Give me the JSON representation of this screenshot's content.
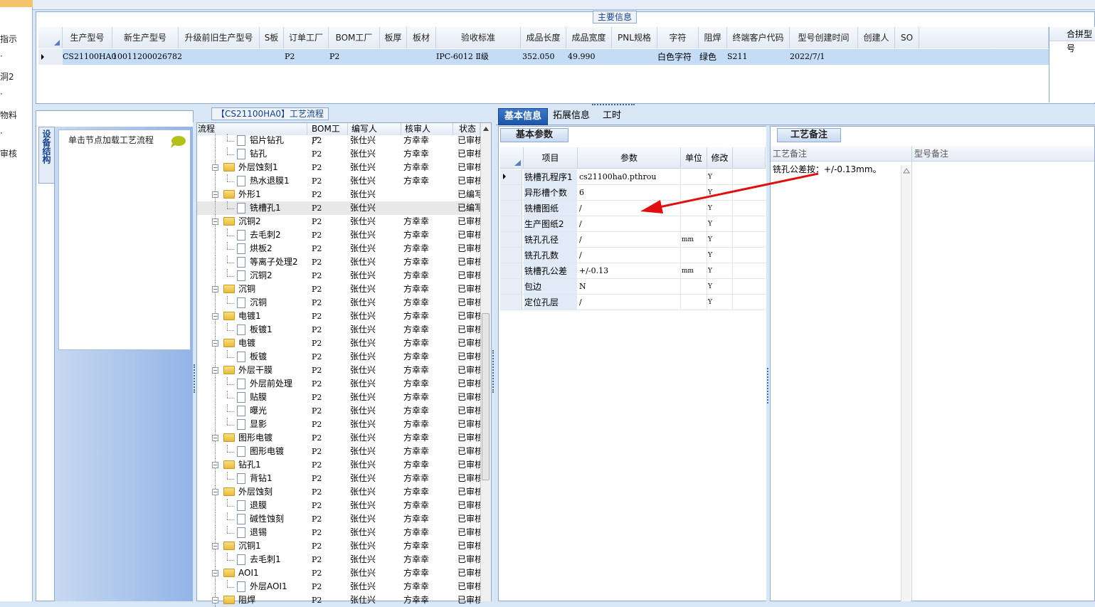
{
  "left_strip": {
    "labels": [
      "指示",
      "·",
      "洞2",
      "·",
      "物料",
      "·",
      "审核"
    ]
  },
  "main_info": {
    "title": "主要信息",
    "columns": [
      "生产型号",
      "新生产型号",
      "升级前旧生产型号",
      "S板",
      "订单工厂",
      "BOM工厂",
      "板厚",
      "板材",
      "验收标准",
      "成品长度",
      "成品宽度",
      "PNL规格",
      "字符",
      "阻焊",
      "终端客户代码",
      "型号创建时间",
      "创建人",
      "SO"
    ],
    "row": {
      "prod_model": "CS21100HA0",
      "new_model": "10011200026782",
      "old_model": "",
      "s_board": "",
      "order_factory": "P2",
      "bom_factory": "P2",
      "thickness": "",
      "material": "",
      "standard": "IPC-6012 Ⅱ级",
      "length": "352.050",
      "width": "49.990",
      "pnl": "",
      "char": "白色字符",
      "solder": "绿色",
      "customer_code": "S211",
      "created": "2022/7/1",
      "creator": "",
      "so": ""
    },
    "merge_label": "合拼型号"
  },
  "left_nav": {
    "tab_label": "设备结构",
    "hint": "单击节点加载工艺流程"
  },
  "flow": {
    "title": "【CS21100HA0】工艺流程",
    "columns": [
      "流程",
      "BOM工厂",
      "编写人",
      "核审人",
      "状态"
    ],
    "rows": [
      {
        "level": 2,
        "name": "铝片钻孔",
        "bom": "P2",
        "writer": "张仕兴",
        "reviewer": "方幸幸",
        "status": "已审核"
      },
      {
        "level": 2,
        "name": "钻孔",
        "bom": "P2",
        "writer": "张仕兴",
        "reviewer": "方幸幸",
        "status": "已审核"
      },
      {
        "level": 1,
        "name": "外层蚀刻1",
        "bom": "P2",
        "writer": "张仕兴",
        "reviewer": "方幸幸",
        "status": "已审核"
      },
      {
        "level": 2,
        "name": "热水退膜1",
        "bom": "P2",
        "writer": "张仕兴",
        "reviewer": "方幸幸",
        "status": "已审核"
      },
      {
        "level": 1,
        "name": "外形1",
        "bom": "P2",
        "writer": "张仕兴",
        "reviewer": "",
        "status": "已编写"
      },
      {
        "level": 2,
        "name": "铣槽孔1",
        "bom": "P2",
        "writer": "张仕兴",
        "reviewer": "",
        "status": "已编写",
        "selected": true
      },
      {
        "level": 1,
        "name": "沉铜2",
        "bom": "P2",
        "writer": "张仕兴",
        "reviewer": "方幸幸",
        "status": "已审核"
      },
      {
        "level": 2,
        "name": "去毛刺2",
        "bom": "P2",
        "writer": "张仕兴",
        "reviewer": "方幸幸",
        "status": "已审核"
      },
      {
        "level": 2,
        "name": "烘板2",
        "bom": "P2",
        "writer": "张仕兴",
        "reviewer": "方幸幸",
        "status": "已审核"
      },
      {
        "level": 2,
        "name": "等离子处理2",
        "bom": "P2",
        "writer": "张仕兴",
        "reviewer": "方幸幸",
        "status": "已审核"
      },
      {
        "level": 2,
        "name": "沉铜2",
        "bom": "P2",
        "writer": "张仕兴",
        "reviewer": "方幸幸",
        "status": "已审核"
      },
      {
        "level": 1,
        "name": "沉铜",
        "bom": "P2",
        "writer": "张仕兴",
        "reviewer": "方幸幸",
        "status": "已审核"
      },
      {
        "level": 2,
        "name": "沉铜",
        "bom": "P2",
        "writer": "张仕兴",
        "reviewer": "方幸幸",
        "status": "已审核"
      },
      {
        "level": 1,
        "name": "电镀1",
        "bom": "P2",
        "writer": "张仕兴",
        "reviewer": "方幸幸",
        "status": "已审核"
      },
      {
        "level": 2,
        "name": "板镀1",
        "bom": "P2",
        "writer": "张仕兴",
        "reviewer": "方幸幸",
        "status": "已审核"
      },
      {
        "level": 1,
        "name": "电镀",
        "bom": "P2",
        "writer": "张仕兴",
        "reviewer": "方幸幸",
        "status": "已审核"
      },
      {
        "level": 2,
        "name": "板镀",
        "bom": "P2",
        "writer": "张仕兴",
        "reviewer": "方幸幸",
        "status": "已审核"
      },
      {
        "level": 1,
        "name": "外层干膜",
        "bom": "P2",
        "writer": "张仕兴",
        "reviewer": "方幸幸",
        "status": "已审核"
      },
      {
        "level": 2,
        "name": "外层前处理",
        "bom": "P2",
        "writer": "张仕兴",
        "reviewer": "方幸幸",
        "status": "已审核"
      },
      {
        "level": 2,
        "name": "贴膜",
        "bom": "P2",
        "writer": "张仕兴",
        "reviewer": "方幸幸",
        "status": "已审核"
      },
      {
        "level": 2,
        "name": "曝光",
        "bom": "P2",
        "writer": "张仕兴",
        "reviewer": "方幸幸",
        "status": "已审核"
      },
      {
        "level": 2,
        "name": "显影",
        "bom": "P2",
        "writer": "张仕兴",
        "reviewer": "方幸幸",
        "status": "已审核"
      },
      {
        "level": 1,
        "name": "图形电镀",
        "bom": "P2",
        "writer": "张仕兴",
        "reviewer": "方幸幸",
        "status": "已审核"
      },
      {
        "level": 2,
        "name": "图形电镀",
        "bom": "P2",
        "writer": "张仕兴",
        "reviewer": "方幸幸",
        "status": "已审核"
      },
      {
        "level": 1,
        "name": "钻孔1",
        "bom": "P2",
        "writer": "张仕兴",
        "reviewer": "方幸幸",
        "status": "已审核"
      },
      {
        "level": 2,
        "name": "背钻1",
        "bom": "P2",
        "writer": "张仕兴",
        "reviewer": "方幸幸",
        "status": "已审核"
      },
      {
        "level": 1,
        "name": "外层蚀刻",
        "bom": "P2",
        "writer": "张仕兴",
        "reviewer": "方幸幸",
        "status": "已审核"
      },
      {
        "level": 2,
        "name": "退膜",
        "bom": "P2",
        "writer": "张仕兴",
        "reviewer": "方幸幸",
        "status": "已审核"
      },
      {
        "level": 2,
        "name": "碱性蚀刻",
        "bom": "P2",
        "writer": "张仕兴",
        "reviewer": "方幸幸",
        "status": "已审核"
      },
      {
        "level": 2,
        "name": "退锡",
        "bom": "P2",
        "writer": "张仕兴",
        "reviewer": "方幸幸",
        "status": "已审核"
      },
      {
        "level": 1,
        "name": "沉铜1",
        "bom": "P2",
        "writer": "张仕兴",
        "reviewer": "方幸幸",
        "status": "已审核"
      },
      {
        "level": 2,
        "name": "去毛刺1",
        "bom": "P2",
        "writer": "张仕兴",
        "reviewer": "方幸幸",
        "status": "已审核"
      },
      {
        "level": 1,
        "name": "AOI1",
        "bom": "P2",
        "writer": "张仕兴",
        "reviewer": "方幸幸",
        "status": "已审核"
      },
      {
        "level": 2,
        "name": "外层AOI1",
        "bom": "P2",
        "writer": "张仕兴",
        "reviewer": "方幸幸",
        "status": "已审核"
      },
      {
        "level": 1,
        "name": "阻焊",
        "bom": "P2",
        "writer": "张仕兴",
        "reviewer": "方幸幸",
        "status": "已审核"
      }
    ]
  },
  "tabs": [
    "基本信息",
    "拓展信息",
    "工时"
  ],
  "basic": {
    "tab_label": "基本参数",
    "columns": [
      "项目",
      "参数",
      "单位",
      "修改"
    ],
    "rows": [
      {
        "item": "铣槽孔程序1",
        "param": "cs21100ha0.pthrou",
        "unit": "",
        "edit": "Y"
      },
      {
        "item": "异形槽个数",
        "param": "6",
        "unit": "",
        "edit": "Y"
      },
      {
        "item": "铣槽图纸",
        "param": "/",
        "unit": "",
        "edit": "Y"
      },
      {
        "item": "生产图纸2",
        "param": "/",
        "unit": "",
        "edit": "Y"
      },
      {
        "item": "铣孔孔径",
        "param": "/",
        "unit": "mm",
        "edit": "Y"
      },
      {
        "item": "铣孔孔数",
        "param": "/",
        "unit": "",
        "edit": "Y"
      },
      {
        "item": "铣槽孔公差",
        "param": "+/-0.13",
        "unit": "mm",
        "edit": "Y"
      },
      {
        "item": "包边",
        "param": "N",
        "unit": "",
        "edit": "Y"
      },
      {
        "item": "定位孔层",
        "param": "/",
        "unit": "",
        "edit": "Y"
      }
    ]
  },
  "notes": {
    "tab_label": "工艺备注",
    "col1": "工艺备注",
    "col2": "型号备注",
    "text": "铣孔公差按：+/-0.13mm。"
  },
  "colors": {
    "accent": "#1d56a8",
    "annotation_arrow": "#e01010",
    "selection": "#c4dcf6"
  }
}
